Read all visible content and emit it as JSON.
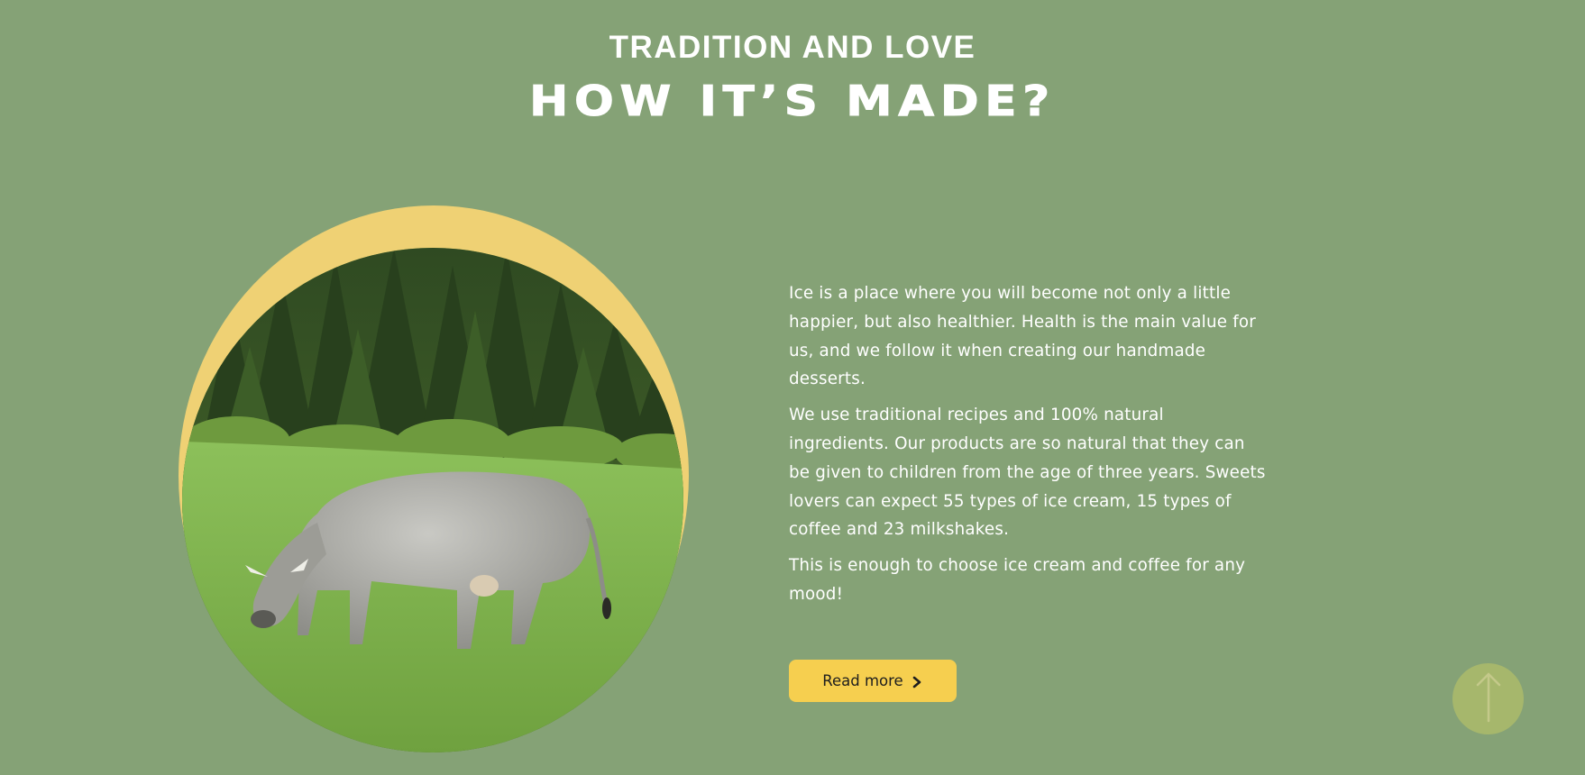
{
  "section": {
    "kicker": "TRADITION AND LOVE",
    "title": "HOW IT’S MADE?"
  },
  "image": {
    "alt": "Grey cow grazing on a green meadow in front of a pine forest"
  },
  "copy": {
    "paragraphs": [
      "Ice is a place where you will become not only a little happier, but also healthier. Health is the main value for us, and we follow it when creating our handmade desserts.",
      "We use traditional recipes and 100% natural ingredients. Our products are so natural that they can be given to children from the age of three years. Sweets lovers can expect 55 types of ice cream, 15 types of coffee and 23 milkshakes.",
      "This is enough to choose ice cream and coffee for any mood!"
    ]
  },
  "cta": {
    "label": "Read more",
    "icon": "chevron-right-icon"
  },
  "scroll_top": {
    "icon": "arrow-up-icon"
  },
  "colors": {
    "background": "#85a276",
    "accent_yellow": "#f6cf4f",
    "ring_yellow": "#efd174",
    "scroll_button": "#a6b76c"
  }
}
